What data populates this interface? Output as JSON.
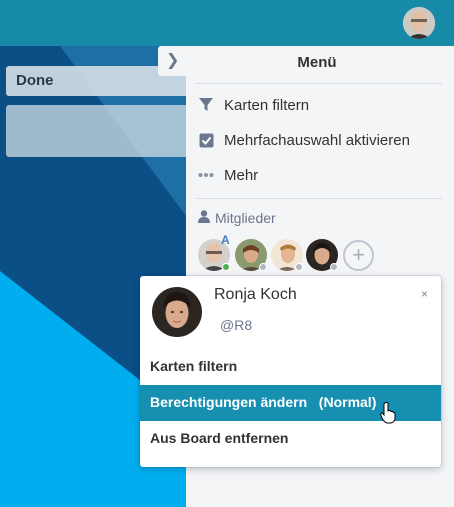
{
  "colors": {
    "header": "#178aa8",
    "sidebar_bg": "#f4f5f7",
    "highlight": "#178fb0",
    "status_online": "#4caf50",
    "status_offline": "#b3b9c4"
  },
  "header": {
    "user_avatar_icon": "user-avatar-icon"
  },
  "board": {
    "list_title": "Done"
  },
  "sidebar": {
    "title": "Menü",
    "collapse_icon": "chevron-right-icon",
    "items": [
      {
        "label": "Karten filtern",
        "icon": "filter-icon"
      },
      {
        "label": "Mehrfachauswahl aktivieren",
        "icon": "checkbox-icon"
      },
      {
        "label": "Mehr",
        "icon": "more-icon"
      }
    ],
    "members_label": "Mitglieder",
    "admin_badge": "A",
    "add_member": "+"
  },
  "popover": {
    "name": "Ronja Koch",
    "username": "@R8",
    "close": "×",
    "items": [
      {
        "label": "Karten filtern"
      },
      {
        "label": "Berechtigungen ändern   (Normal)"
      },
      {
        "label": "Aus Board entfernen"
      }
    ]
  }
}
